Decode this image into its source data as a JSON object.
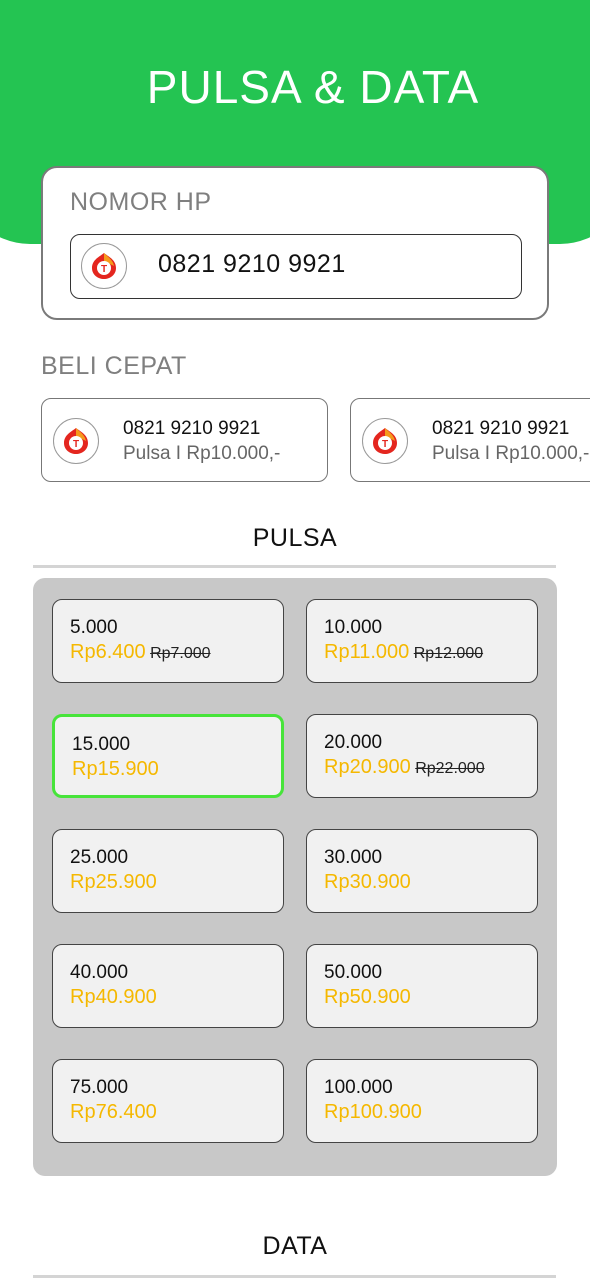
{
  "header": {
    "title": "PULSA & DATA",
    "color": "#24c452"
  },
  "phone": {
    "label": "NOMOR HP",
    "value": "0821 9210 9921",
    "provider_icon": "telkomsel-logo-icon"
  },
  "quick_buy": {
    "label": "BELI CEPAT",
    "items": [
      {
        "number": "0821 9210 9921",
        "detail": "Pulsa I Rp10.000,-"
      },
      {
        "number": "0821 9210 9921",
        "detail": "Pulsa I Rp10.000,-"
      }
    ]
  },
  "pulsa": {
    "title": "PULSA",
    "selected_index": 2,
    "options": [
      {
        "nominal": "5.000",
        "price": "Rp6.400",
        "old_price": "Rp7.000"
      },
      {
        "nominal": "10.000",
        "price": "Rp11.000",
        "old_price": "Rp12.000"
      },
      {
        "nominal": "15.000",
        "price": "Rp15.900",
        "old_price": ""
      },
      {
        "nominal": "20.000",
        "price": "Rp20.900",
        "old_price": "Rp22.000"
      },
      {
        "nominal": "25.000",
        "price": "Rp25.900",
        "old_price": ""
      },
      {
        "nominal": "30.000",
        "price": "Rp30.900",
        "old_price": ""
      },
      {
        "nominal": "40.000",
        "price": "Rp40.900",
        "old_price": ""
      },
      {
        "nominal": "50.000",
        "price": "Rp50.900",
        "old_price": ""
      },
      {
        "nominal": "75.000",
        "price": "Rp76.400",
        "old_price": ""
      },
      {
        "nominal": "100.000",
        "price": "Rp100.900",
        "old_price": ""
      }
    ]
  },
  "data_section": {
    "title": "DATA"
  },
  "colors": {
    "price": "#f5b800",
    "selected_border": "#47e43a",
    "panel": "#c8c8c8"
  }
}
